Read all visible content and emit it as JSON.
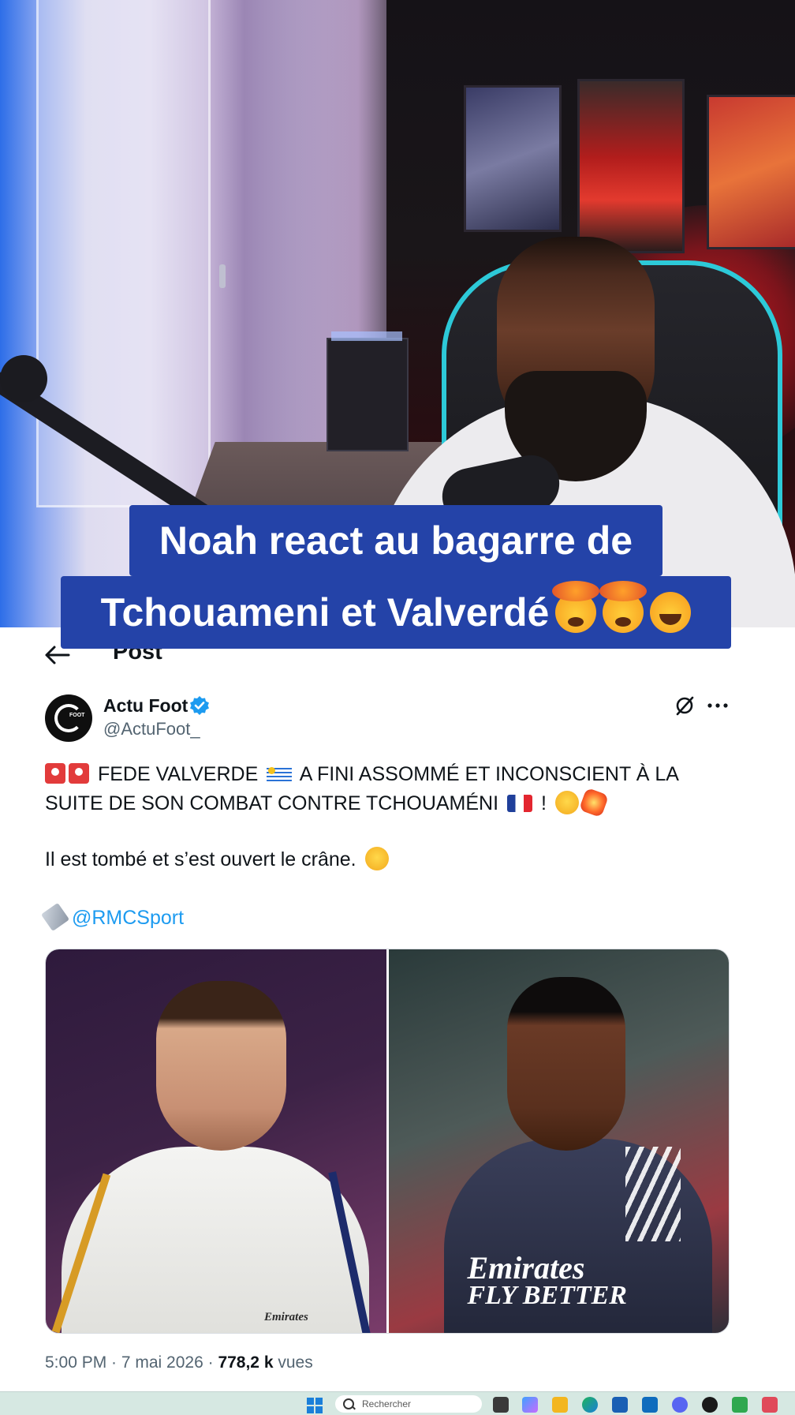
{
  "overlay": {
    "caption_line_1": "Noah react au bagarre de",
    "caption_line_2": "Tchouameni et Valverdé",
    "caption_emojis": [
      "exploding-head",
      "exploding-head",
      "rolling-laughing"
    ]
  },
  "post": {
    "header_title": "Post",
    "author": {
      "display_name": "Actu Foot",
      "handle": "@ActuFoot_",
      "verified": true,
      "avatar_text": "FOOT"
    },
    "text": {
      "line1_part1": "FEDE VALVERDE",
      "line1_part2": "A FINI ASSOMMÉ ET INCONSCIENT À LA SUITE DE SON COMBAT CONTRE TCHOUAMÉNI",
      "line1_part3": "!",
      "line2": "Il est tombé et s’est ouvert le crâne.",
      "mention": "@RMCSport"
    },
    "media": {
      "left_sponsor": "Emirates",
      "right_sponsor_1": "Emirates",
      "right_sponsor_2": "FLY BETTER"
    },
    "meta": {
      "time_date": "5:00 PM · 7 mai 2026 · ",
      "views_count": "778,2 k",
      "views_label": " vues"
    }
  },
  "taskbar": {
    "search_placeholder": "Rechercher"
  },
  "colors": {
    "caption_bg": "#2443a8",
    "link": "#1d9bf0",
    "verified": "#1d9bf0",
    "muted_text": "#536471"
  }
}
